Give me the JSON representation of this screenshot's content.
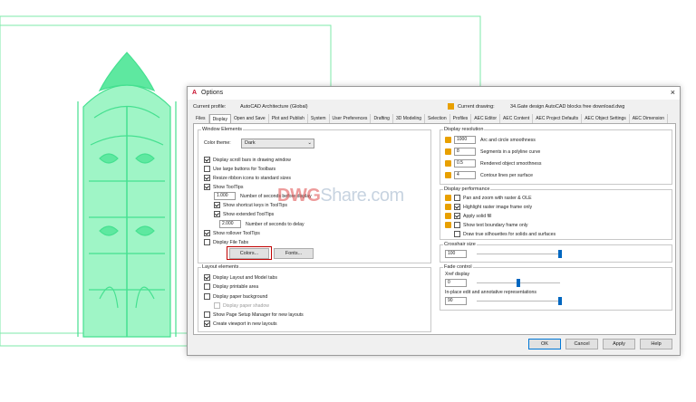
{
  "dialog": {
    "title": "Options",
    "close": "×"
  },
  "profile": {
    "current_profile_label": "Current profile:",
    "current_profile_value": "AutoCAD Architecture (Global)",
    "current_drawing_label": "Current drawing:",
    "current_drawing_value": "34.Gate design AutoCAD blocks free download.dwg"
  },
  "tabs": [
    "Files",
    "Display",
    "Open and Save",
    "Plot and Publish",
    "System",
    "User Preferences",
    "Drafting",
    "3D Modeling",
    "Selection",
    "Profiles",
    "AEC Editor",
    "AEC Content",
    "AEC Project Defaults",
    "AEC Object Settings",
    "AEC Dimension"
  ],
  "active_tab": "Display",
  "window_elements": {
    "title": "Window Elements",
    "color_theme_label": "Color theme:",
    "color_theme_value": "Dark",
    "items": [
      {
        "label": "Display scroll bars in drawing window",
        "checked": true
      },
      {
        "label": "Use large buttons for Toolbars",
        "checked": false
      },
      {
        "label": "Resize ribbon icons to standard sizes",
        "checked": true
      },
      {
        "label": "Show ToolTips",
        "checked": true
      }
    ],
    "tooltip_delay_value": "1.000",
    "tooltip_delay_label": "Number of seconds before display",
    "shortcut_keys_label": "Show shortcut keys in ToolTips",
    "extended_label": "Show extended ToolTips",
    "extended_delay_value": "2.000",
    "extended_delay_label": "Number of seconds to delay",
    "rollover_label": "Show rollover ToolTips",
    "file_tabs_label": "Display File Tabs",
    "colors_button": "Colors...",
    "fonts_button": "Fonts..."
  },
  "layout_elements": {
    "title": "Layout elements",
    "items": [
      {
        "label": "Display Layout and Model tabs",
        "checked": true
      },
      {
        "label": "Display printable area",
        "checked": false
      },
      {
        "label": "Display paper background",
        "checked": false
      },
      {
        "label": "Display paper shadow",
        "checked": false,
        "disabled": true
      },
      {
        "label": "Show Page Setup Manager for new layouts",
        "checked": false
      },
      {
        "label": "Create viewport in new layouts",
        "checked": true
      }
    ]
  },
  "display_resolution": {
    "title": "Display resolution",
    "items": [
      {
        "value": "1000",
        "label": "Arc and circle smoothness"
      },
      {
        "value": "8",
        "label": "Segments in a polyline curve"
      },
      {
        "value": "0.5",
        "label": "Rendered object smoothness"
      },
      {
        "value": "4",
        "label": "Contour lines per surface"
      }
    ]
  },
  "display_performance": {
    "title": "Display performance",
    "items": [
      {
        "label": "Pan and zoom with raster & OLE",
        "checked": false
      },
      {
        "label": "Highlight raster image frame only",
        "checked": true
      },
      {
        "label": "Apply solid fill",
        "checked": true
      },
      {
        "label": "Show text boundary frame only",
        "checked": false
      },
      {
        "label": "Draw true silhouettes for solids and surfaces",
        "checked": false
      }
    ]
  },
  "crosshair": {
    "title": "Crosshair size",
    "value": "100",
    "level": 1.0
  },
  "fade_control": {
    "title": "Fade control",
    "xref_label": "Xref display",
    "xref_value": "0",
    "xref_level": 0.5,
    "inplace_label": "In-place edit and annotative representations",
    "inplace_value": "90",
    "inplace_level": 1.0
  },
  "buttons": {
    "ok": "OK",
    "cancel": "Cancel",
    "apply": "Apply",
    "help": "Help"
  },
  "watermark": {
    "part1": "DWG",
    "part2": "Share.com"
  },
  "colors": {
    "cad_line": "#7ee8a8",
    "cad_fill": "#55e89a",
    "accent": "#0067c0",
    "highlight": "#c00000"
  }
}
